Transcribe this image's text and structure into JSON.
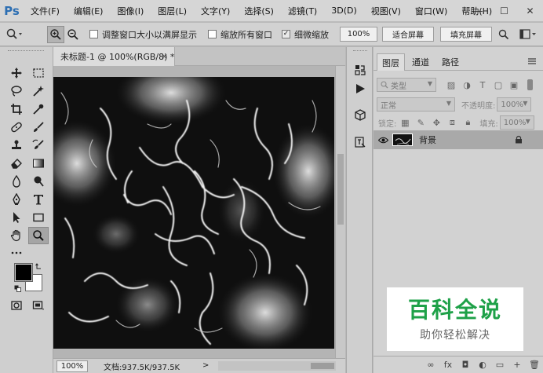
{
  "app": {
    "logo": "Ps"
  },
  "menu": [
    "文件(F)",
    "编辑(E)",
    "图像(I)",
    "图层(L)",
    "文字(Y)",
    "选择(S)",
    "滤镜(T)",
    "3D(D)",
    "视图(V)",
    "窗口(W)",
    "帮助(H)"
  ],
  "window_controls": {
    "minimize": "—",
    "maximize": "☐",
    "close": "✕"
  },
  "options": {
    "resize_windows_label": "调整窗口大小以满屏显示",
    "resize_windows_checked": false,
    "zoom_all_label": "缩放所有窗口",
    "zoom_all_checked": false,
    "scrubby_label": "细微缩放",
    "scrubby_checked": true,
    "zoom_value": "100%",
    "fit_screen_label": "适合屏幕",
    "fill_screen_label": "填充屏幕"
  },
  "document": {
    "tab_title": "未标题-1 @ 100%(RGB/8) *",
    "close_glyph": "×",
    "zoom_display": "100%",
    "doc_info": "文档:937.5K/937.5K",
    "status_arrow": ">"
  },
  "layers_panel": {
    "tabs": [
      "图层",
      "通道",
      "路径"
    ],
    "active_tab": 0,
    "filter_label": "类型",
    "blend_mode": "正常",
    "opacity_label": "不透明度:",
    "opacity_value": "100%",
    "lock_label": "锁定:",
    "fill_label": "填充:",
    "fill_value": "100%",
    "layer_name": "背景",
    "bottom_icons": [
      "∞",
      "fx",
      "◘",
      "◐",
      "▭",
      "+",
      "🗑"
    ]
  },
  "watermark": {
    "title": "百科全说",
    "subtitle": "助你轻松解决"
  },
  "colors": {
    "foreground": "#000000",
    "background": "#ffffff",
    "accent_logo": "#2d6fb3",
    "watermark_green": "#1ea148"
  }
}
